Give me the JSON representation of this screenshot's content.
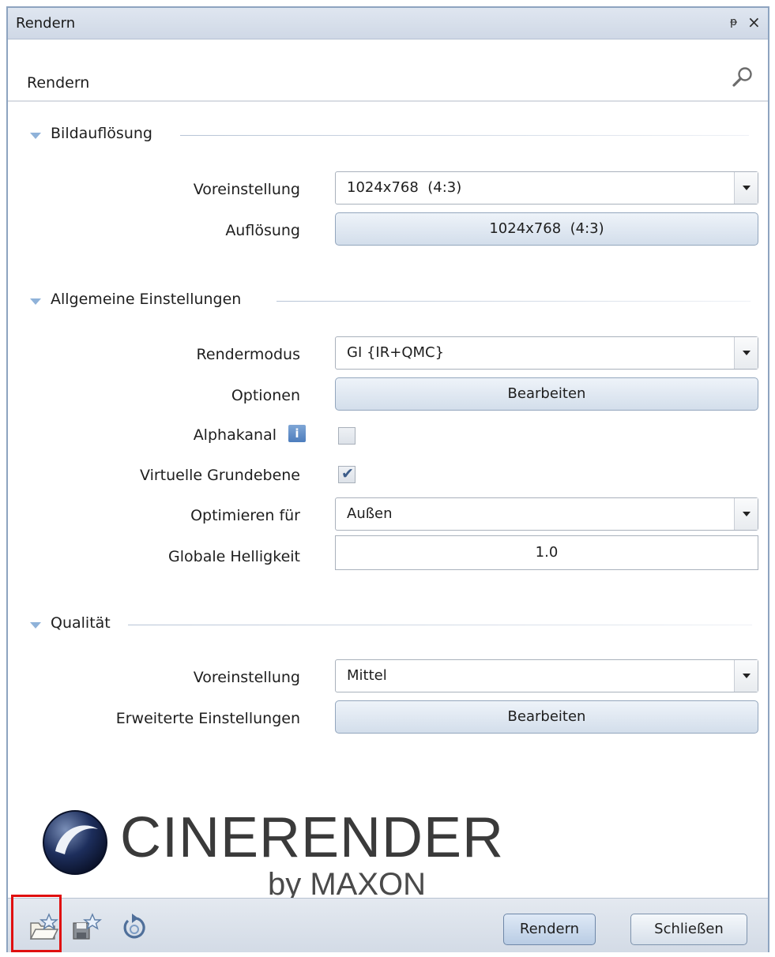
{
  "window": {
    "title": "Rendern",
    "pin_glyph": "ᵽ",
    "close_glyph": "×"
  },
  "subheader": {
    "label": "Rendern",
    "search_icon": "magnifier-icon"
  },
  "sections": {
    "resolution": {
      "title": "Bildauflösung",
      "preset_label": "Voreinstellung",
      "preset_value": "1024x768  (4:3)",
      "resolution_label": "Auflösung",
      "resolution_button": "1024x768  (4:3)"
    },
    "general": {
      "title": "Allgemeine Einstellungen",
      "rendermode_label": "Rendermodus",
      "rendermode_value": "GI {IR+QMC}",
      "options_label": "Optionen",
      "options_button": "Bearbeiten",
      "alpha_label": "Alphakanal",
      "alpha_checked": false,
      "ground_label": "Virtuelle Grundebene",
      "ground_checked": true,
      "optimize_label": "Optimieren für",
      "optimize_value": "Außen",
      "brightness_label": "Globale Helligkeit",
      "brightness_value": "1.0"
    },
    "quality": {
      "title": "Qualität",
      "preset_label": "Voreinstellung",
      "preset_value": "Mittel",
      "advanced_label": "Erweiterte Einstellungen",
      "advanced_button": "Bearbeiten"
    }
  },
  "logo": {
    "name": "CINERENDER",
    "byline": "by MAXON"
  },
  "footer": {
    "icons": [
      "open-favorites-icon",
      "save-favorites-icon",
      "reset-icon"
    ],
    "render_button": "Rendern",
    "close_button": "Schließen"
  },
  "colors": {
    "accent": "#8fb2d9",
    "highlight": "#e01010",
    "titlebar": "#d5dde9"
  }
}
